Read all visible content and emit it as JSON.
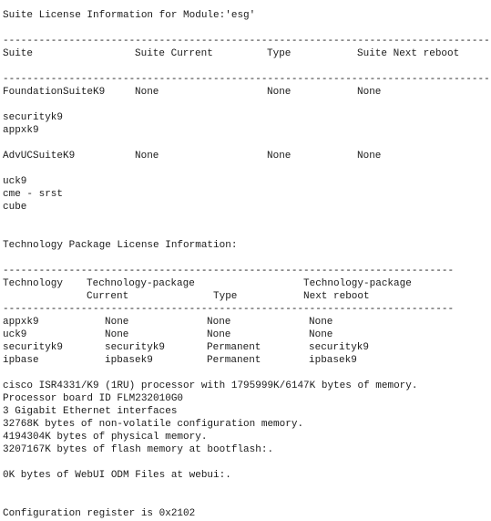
{
  "suite_section": {
    "title": "Suite License Information for Module:'esg'",
    "divider": "-----------------------------------------------------------------------------------",
    "headers": [
      "Suite",
      "Suite Current",
      "Type",
      "Suite Next reboot"
    ],
    "suites": [
      {
        "name": "FoundationSuiteK9",
        "current": "None",
        "type": "None",
        "next_reboot": "None",
        "packages": [
          "securityk9",
          "appxk9"
        ]
      },
      {
        "name": "AdvUCSuiteK9",
        "current": "None",
        "type": "None",
        "next_reboot": "None",
        "packages": [
          "uck9",
          "cme - srst",
          "cube"
        ]
      }
    ]
  },
  "tech_section": {
    "title": "Technology Package License Information:",
    "divider": "---------------------------------------------------------------------------",
    "header_row1": [
      "Technology",
      "Technology-package",
      "",
      "Technology-package"
    ],
    "header_row2": [
      "",
      "Current",
      "Type",
      "Next reboot"
    ],
    "rows": [
      [
        "appxk9",
        "None",
        "None",
        "None"
      ],
      [
        "uck9",
        "None",
        "None",
        "None"
      ],
      [
        "securityk9",
        "securityk9",
        "Permanent",
        "securityk9"
      ],
      [
        "ipbase",
        "ipbasek9",
        "Permanent",
        "ipbasek9"
      ]
    ]
  },
  "hardware_info": [
    "cisco ISR4331/K9 (1RU) processor with 1795999K/6147K bytes of memory.",
    "Processor board ID FLM232010G0",
    "3 Gigabit Ethernet interfaces",
    "32768K bytes of non-volatile configuration memory.",
    "4194304K bytes of physical memory.",
    "3207167K bytes of flash memory at bootflash:."
  ],
  "webui_info": "0K bytes of WebUI ODM Files at webui:.",
  "config_register": "Configuration register is 0x2102"
}
